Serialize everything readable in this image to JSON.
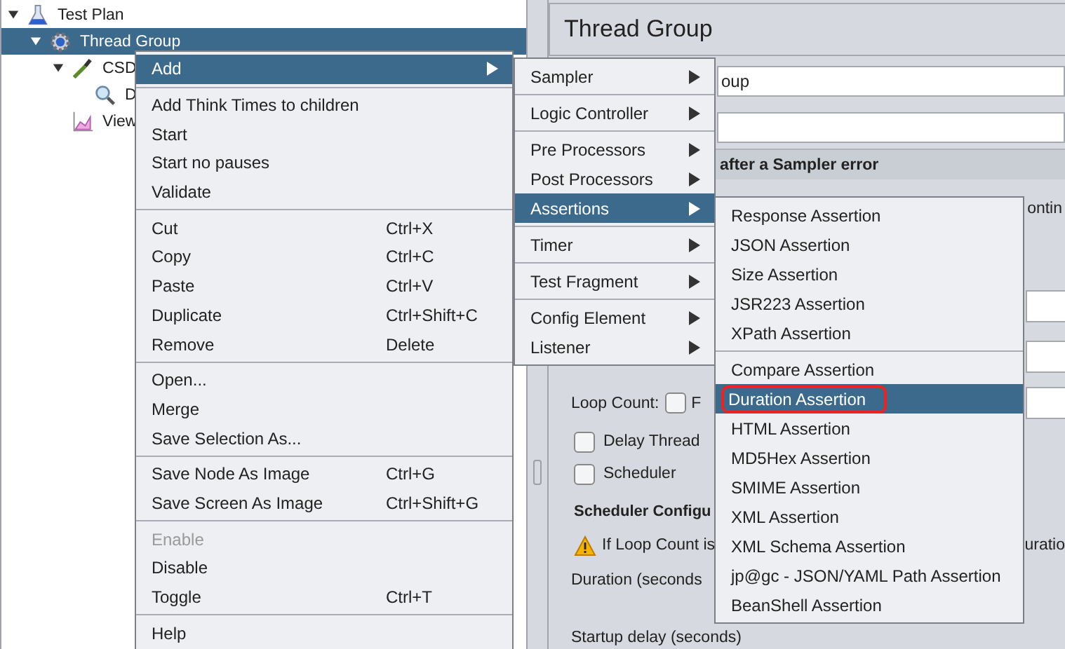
{
  "tree": [
    {
      "label": "Test Plan",
      "expanded": true,
      "selected": false,
      "children": [
        {
          "label": "Thread Group",
          "expanded": true,
          "selected": true,
          "children": [
            {
              "label": "CSD",
              "expanded": true,
              "selected": false,
              "children": [
                {
                  "label": "D",
                  "selected": false
                }
              ]
            },
            {
              "label": "View",
              "selected": false
            }
          ]
        }
      ]
    }
  ],
  "panel": {
    "title": "Thread Group",
    "name_value": "oup",
    "section_header": "after a Sampler error",
    "action_text": "ontin",
    "loop_count_label": "Loop Count:",
    "forever_checked": false,
    "forever_label": "F",
    "delay_checked": false,
    "delay_label": "Delay Thread",
    "scheduler_checked": false,
    "scheduler_label": "Scheduler",
    "scheduler_config_title": "Scheduler Configu",
    "warning_left": "If Loop Count is",
    "warning_right": "uratio",
    "duration_label": "Duration (seconds",
    "startup_label": "Startup delay (seconds)"
  },
  "context_menu": {
    "groups": [
      [
        {
          "label": "Add",
          "submenu": true,
          "selected": true,
          "disabled": false
        }
      ],
      [
        {
          "label": "Add Think Times to children",
          "selected": false,
          "disabled": false
        },
        {
          "label": "Start",
          "selected": false,
          "disabled": false
        },
        {
          "label": "Start no pauses",
          "selected": false,
          "disabled": false
        },
        {
          "label": "Validate",
          "selected": false,
          "disabled": false
        }
      ],
      [
        {
          "label": "Cut",
          "shortcut": "Ctrl+X",
          "selected": false,
          "disabled": false
        },
        {
          "label": "Copy",
          "shortcut": "Ctrl+C",
          "selected": false,
          "disabled": false
        },
        {
          "label": "Paste",
          "shortcut": "Ctrl+V",
          "selected": false,
          "disabled": false
        },
        {
          "label": "Duplicate",
          "shortcut": "Ctrl+Shift+C",
          "selected": false,
          "disabled": false
        },
        {
          "label": "Remove",
          "shortcut": "Delete",
          "selected": false,
          "disabled": false
        }
      ],
      [
        {
          "label": "Open...",
          "selected": false,
          "disabled": false
        },
        {
          "label": "Merge",
          "selected": false,
          "disabled": false
        },
        {
          "label": "Save Selection As...",
          "selected": false,
          "disabled": false
        }
      ],
      [
        {
          "label": "Save Node As Image",
          "shortcut": "Ctrl+G",
          "selected": false,
          "disabled": false
        },
        {
          "label": "Save Screen As Image",
          "shortcut": "Ctrl+Shift+G",
          "selected": false,
          "disabled": false
        }
      ],
      [
        {
          "label": "Enable",
          "selected": false,
          "disabled": true
        },
        {
          "label": "Disable",
          "selected": false,
          "disabled": false
        },
        {
          "label": "Toggle",
          "shortcut": "Ctrl+T",
          "selected": false,
          "disabled": false
        }
      ],
      [
        {
          "label": "Help",
          "selected": false,
          "disabled": false
        }
      ]
    ]
  },
  "add_submenu": {
    "groups": [
      [
        {
          "label": "Sampler",
          "submenu": true,
          "selected": false
        }
      ],
      [
        {
          "label": "Logic Controller",
          "submenu": true,
          "selected": false
        }
      ],
      [
        {
          "label": "Pre Processors",
          "submenu": true,
          "selected": false
        },
        {
          "label": "Post Processors",
          "submenu": true,
          "selected": false
        },
        {
          "label": "Assertions",
          "submenu": true,
          "selected": true
        }
      ],
      [
        {
          "label": "Timer",
          "submenu": true,
          "selected": false
        }
      ],
      [
        {
          "label": "Test Fragment",
          "submenu": true,
          "selected": false
        }
      ],
      [
        {
          "label": "Config Element",
          "submenu": true,
          "selected": false
        },
        {
          "label": "Listener",
          "submenu": true,
          "selected": false
        }
      ]
    ]
  },
  "assertions_submenu": {
    "groups": [
      [
        {
          "label": "Response Assertion",
          "selected": false,
          "outlined": false
        },
        {
          "label": "JSON Assertion",
          "selected": false,
          "outlined": false
        },
        {
          "label": "Size Assertion",
          "selected": false,
          "outlined": false
        },
        {
          "label": "JSR223 Assertion",
          "selected": false,
          "outlined": false
        },
        {
          "label": "XPath Assertion",
          "selected": false,
          "outlined": false
        }
      ],
      [
        {
          "label": "Compare Assertion",
          "selected": false,
          "outlined": false
        },
        {
          "label": "Duration Assertion",
          "selected": true,
          "outlined": true
        },
        {
          "label": "HTML Assertion",
          "selected": false,
          "outlined": false
        },
        {
          "label": "MD5Hex Assertion",
          "selected": false,
          "outlined": false
        },
        {
          "label": "SMIME Assertion",
          "selected": false,
          "outlined": false
        },
        {
          "label": "XML Assertion",
          "selected": false,
          "outlined": false
        },
        {
          "label": "XML Schema Assertion",
          "selected": false,
          "outlined": false
        },
        {
          "label": "jp@gc - JSON/YAML Path Assertion",
          "selected": false,
          "outlined": false
        },
        {
          "label": "BeanShell Assertion",
          "selected": false,
          "outlined": false
        }
      ]
    ]
  }
}
